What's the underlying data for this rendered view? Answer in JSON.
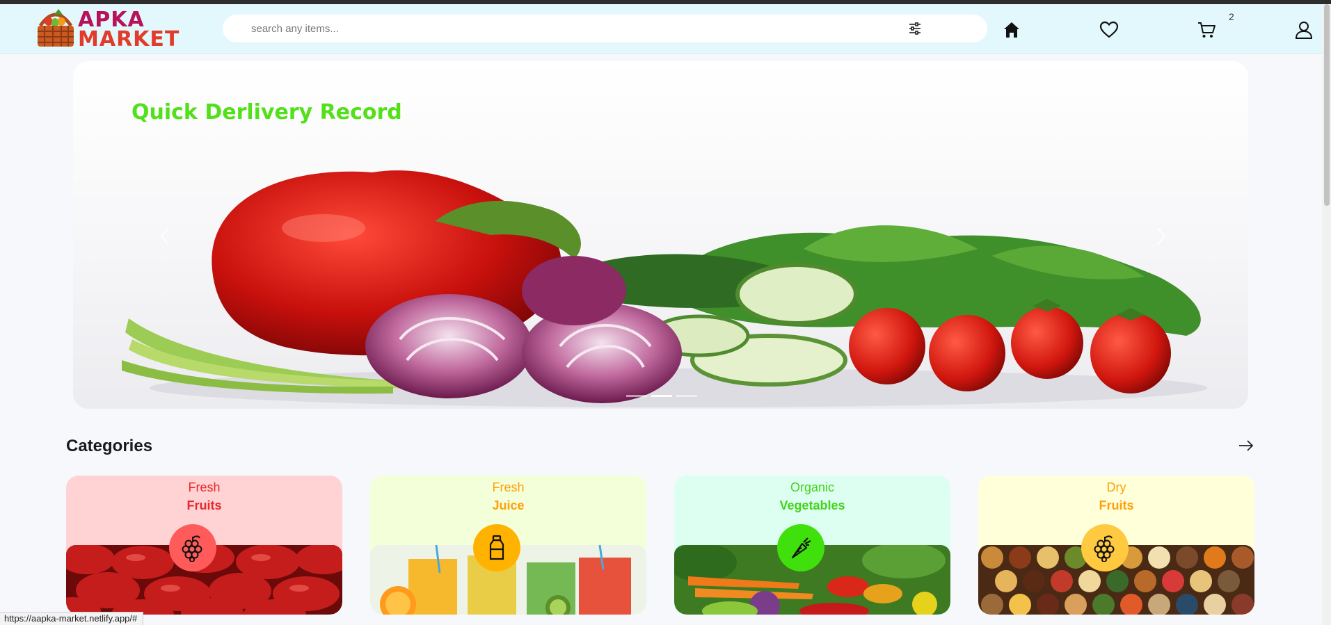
{
  "brand": {
    "line1": "APKA",
    "line2": "MARKET"
  },
  "search": {
    "placeholder": "search any items...",
    "value": ""
  },
  "nav": {
    "icons": [
      "home-icon",
      "heart-icon",
      "cart-icon",
      "user-icon"
    ],
    "cart_count": "2"
  },
  "hero": {
    "title": "Quick Derlivery Record",
    "slides": 3,
    "active_slide": 2
  },
  "categories": {
    "heading": "Categories",
    "items": [
      {
        "sub": "Fresh",
        "main": "Fruits",
        "icon": "grapes-icon",
        "bg": "#ffd3d3",
        "text_color": "#e8262b",
        "badge": "#ff5b5b"
      },
      {
        "sub": "Fresh",
        "main": "Juice",
        "icon": "juice-bottle-icon",
        "bg": "#f3ffd8",
        "text_color": "#ff9f0a",
        "badge": "#ffb300"
      },
      {
        "sub": "Organic",
        "main": "Vegetables",
        "icon": "carrot-icon",
        "bg": "#dcfff2",
        "text_color": "#43d31a",
        "badge": "#3fe00b"
      },
      {
        "sub": "Dry",
        "main": "Fruits",
        "icon": "grapes-icon",
        "bg": "#ffffd9",
        "text_color": "#ff9f0a",
        "badge": "#ffc940"
      }
    ]
  },
  "status_bar": {
    "url": "https://aapka-market.netlify.app/#"
  },
  "colors": {
    "header_bg": "#e2f8fd",
    "accent_green": "#52e01a",
    "page_bg": "#f7f8fc"
  }
}
